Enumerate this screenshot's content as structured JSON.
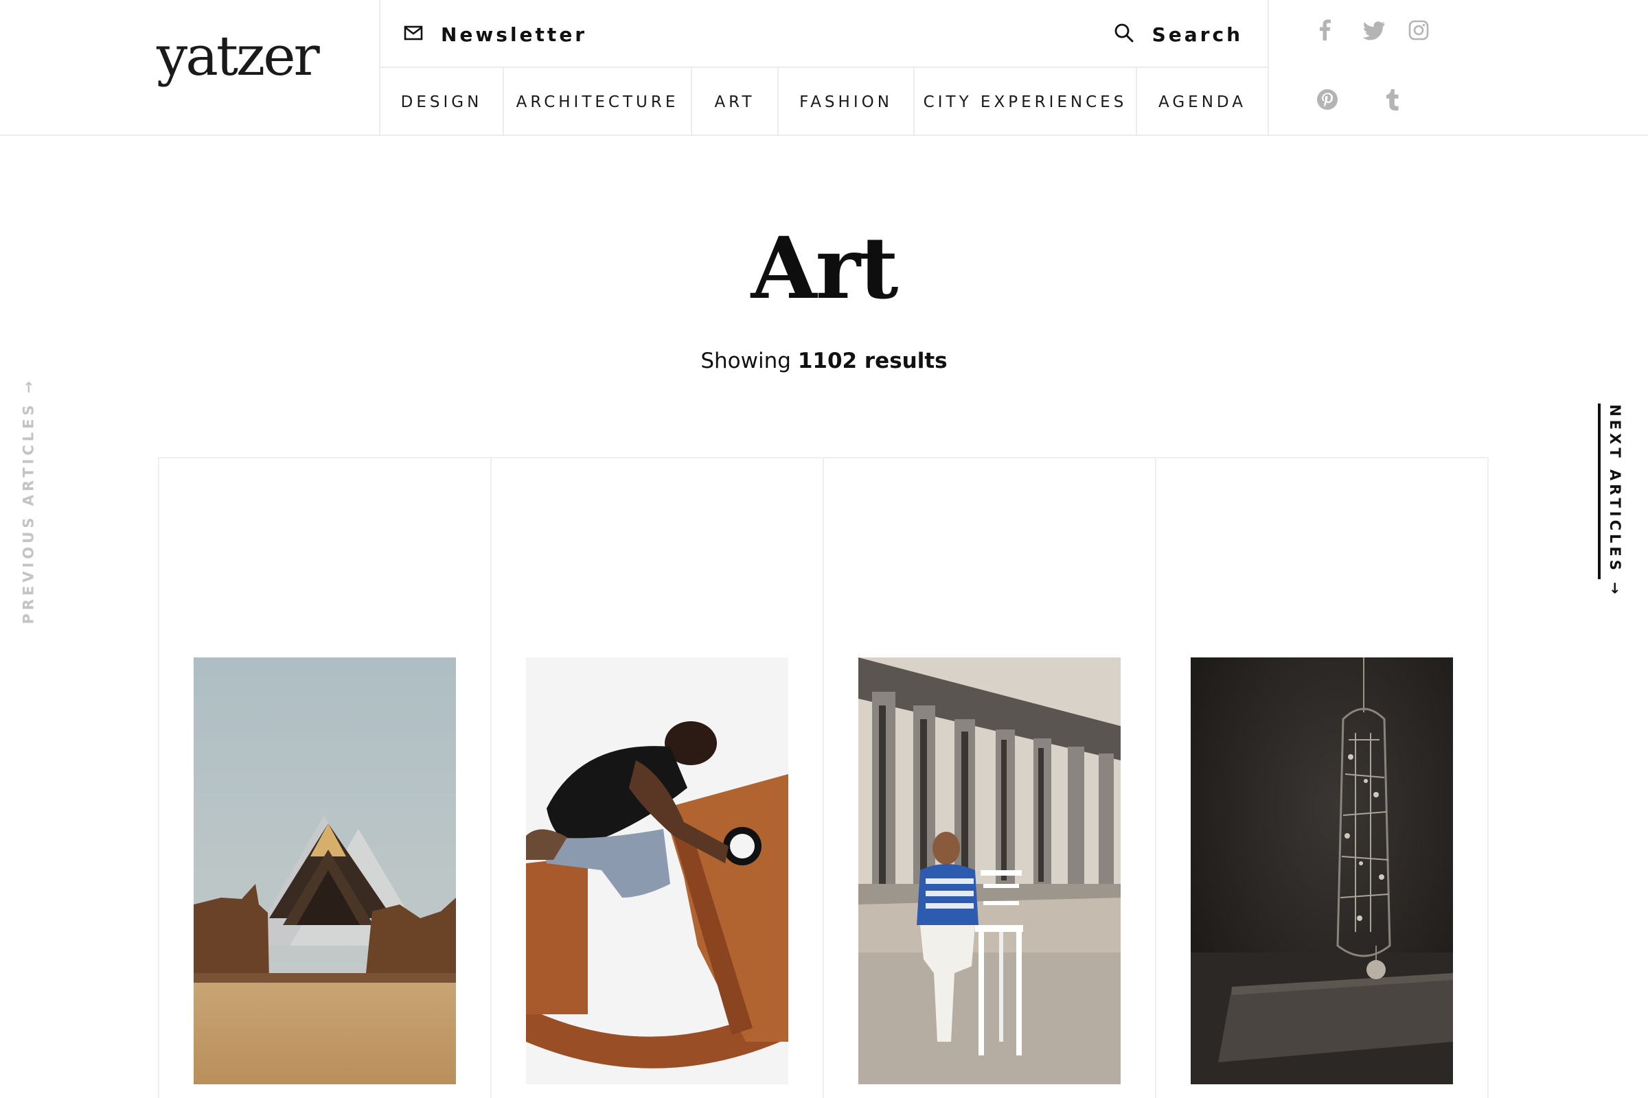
{
  "brand": {
    "logo_text": "yatzer"
  },
  "header": {
    "newsletter_label": "Newsletter",
    "search_label": "Search",
    "nav": [
      {
        "label": "DESIGN"
      },
      {
        "label": "ARCHITECTURE"
      },
      {
        "label": "ART"
      },
      {
        "label": "FASHION"
      },
      {
        "label": "CITY EXPERIENCES"
      },
      {
        "label": "AGENDA"
      }
    ],
    "socials": [
      "facebook-icon",
      "twitter-icon",
      "instagram-icon",
      "pinterest-icon",
      "tumblr-icon"
    ]
  },
  "main": {
    "title": "Art",
    "results_prefix": "Showing",
    "results_count": "1102 results"
  },
  "side": {
    "previous_label": "PREVIOUS ARTICLES →",
    "next_label": "NEXT ARTICLES →"
  },
  "cards": [
    {
      "image": "desert-pyramids-sculpture"
    },
    {
      "image": "man-on-wooden-rocking-chair"
    },
    {
      "image": "man-at-parthenon-with-chair"
    },
    {
      "image": "hanging-sculpture-dark-room"
    }
  ],
  "colors": {
    "border": "#ececec",
    "text": "#111111",
    "social_icon": "#b4b4b4",
    "prev_link": "#c4c4c4"
  }
}
